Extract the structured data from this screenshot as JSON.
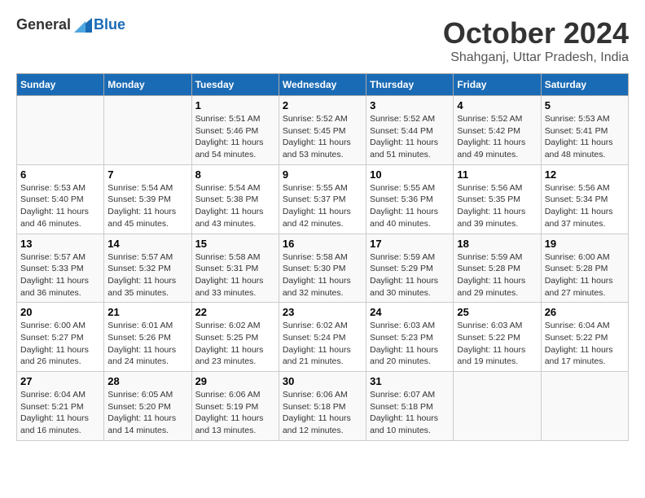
{
  "header": {
    "logo_general": "General",
    "logo_blue": "Blue",
    "month_title": "October 2024",
    "location": "Shahganj, Uttar Pradesh, India"
  },
  "weekdays": [
    "Sunday",
    "Monday",
    "Tuesday",
    "Wednesday",
    "Thursday",
    "Friday",
    "Saturday"
  ],
  "weeks": [
    [
      null,
      null,
      {
        "day": 1,
        "sunrise": "5:51 AM",
        "sunset": "5:46 PM",
        "daylight": "11 hours and 54 minutes."
      },
      {
        "day": 2,
        "sunrise": "5:52 AM",
        "sunset": "5:45 PM",
        "daylight": "11 hours and 53 minutes."
      },
      {
        "day": 3,
        "sunrise": "5:52 AM",
        "sunset": "5:44 PM",
        "daylight": "11 hours and 51 minutes."
      },
      {
        "day": 4,
        "sunrise": "5:52 AM",
        "sunset": "5:42 PM",
        "daylight": "11 hours and 49 minutes."
      },
      {
        "day": 5,
        "sunrise": "5:53 AM",
        "sunset": "5:41 PM",
        "daylight": "11 hours and 48 minutes."
      }
    ],
    [
      {
        "day": 6,
        "sunrise": "5:53 AM",
        "sunset": "5:40 PM",
        "daylight": "11 hours and 46 minutes."
      },
      {
        "day": 7,
        "sunrise": "5:54 AM",
        "sunset": "5:39 PM",
        "daylight": "11 hours and 45 minutes."
      },
      {
        "day": 8,
        "sunrise": "5:54 AM",
        "sunset": "5:38 PM",
        "daylight": "11 hours and 43 minutes."
      },
      {
        "day": 9,
        "sunrise": "5:55 AM",
        "sunset": "5:37 PM",
        "daylight": "11 hours and 42 minutes."
      },
      {
        "day": 10,
        "sunrise": "5:55 AM",
        "sunset": "5:36 PM",
        "daylight": "11 hours and 40 minutes."
      },
      {
        "day": 11,
        "sunrise": "5:56 AM",
        "sunset": "5:35 PM",
        "daylight": "11 hours and 39 minutes."
      },
      {
        "day": 12,
        "sunrise": "5:56 AM",
        "sunset": "5:34 PM",
        "daylight": "11 hours and 37 minutes."
      }
    ],
    [
      {
        "day": 13,
        "sunrise": "5:57 AM",
        "sunset": "5:33 PM",
        "daylight": "11 hours and 36 minutes."
      },
      {
        "day": 14,
        "sunrise": "5:57 AM",
        "sunset": "5:32 PM",
        "daylight": "11 hours and 35 minutes."
      },
      {
        "day": 15,
        "sunrise": "5:58 AM",
        "sunset": "5:31 PM",
        "daylight": "11 hours and 33 minutes."
      },
      {
        "day": 16,
        "sunrise": "5:58 AM",
        "sunset": "5:30 PM",
        "daylight": "11 hours and 32 minutes."
      },
      {
        "day": 17,
        "sunrise": "5:59 AM",
        "sunset": "5:29 PM",
        "daylight": "11 hours and 30 minutes."
      },
      {
        "day": 18,
        "sunrise": "5:59 AM",
        "sunset": "5:28 PM",
        "daylight": "11 hours and 29 minutes."
      },
      {
        "day": 19,
        "sunrise": "6:00 AM",
        "sunset": "5:28 PM",
        "daylight": "11 hours and 27 minutes."
      }
    ],
    [
      {
        "day": 20,
        "sunrise": "6:00 AM",
        "sunset": "5:27 PM",
        "daylight": "11 hours and 26 minutes."
      },
      {
        "day": 21,
        "sunrise": "6:01 AM",
        "sunset": "5:26 PM",
        "daylight": "11 hours and 24 minutes."
      },
      {
        "day": 22,
        "sunrise": "6:02 AM",
        "sunset": "5:25 PM",
        "daylight": "11 hours and 23 minutes."
      },
      {
        "day": 23,
        "sunrise": "6:02 AM",
        "sunset": "5:24 PM",
        "daylight": "11 hours and 21 minutes."
      },
      {
        "day": 24,
        "sunrise": "6:03 AM",
        "sunset": "5:23 PM",
        "daylight": "11 hours and 20 minutes."
      },
      {
        "day": 25,
        "sunrise": "6:03 AM",
        "sunset": "5:22 PM",
        "daylight": "11 hours and 19 minutes."
      },
      {
        "day": 26,
        "sunrise": "6:04 AM",
        "sunset": "5:22 PM",
        "daylight": "11 hours and 17 minutes."
      }
    ],
    [
      {
        "day": 27,
        "sunrise": "6:04 AM",
        "sunset": "5:21 PM",
        "daylight": "11 hours and 16 minutes."
      },
      {
        "day": 28,
        "sunrise": "6:05 AM",
        "sunset": "5:20 PM",
        "daylight": "11 hours and 14 minutes."
      },
      {
        "day": 29,
        "sunrise": "6:06 AM",
        "sunset": "5:19 PM",
        "daylight": "11 hours and 13 minutes."
      },
      {
        "day": 30,
        "sunrise": "6:06 AM",
        "sunset": "5:18 PM",
        "daylight": "11 hours and 12 minutes."
      },
      {
        "day": 31,
        "sunrise": "6:07 AM",
        "sunset": "5:18 PM",
        "daylight": "11 hours and 10 minutes."
      },
      null,
      null
    ]
  ],
  "labels": {
    "sunrise_prefix": "Sunrise: ",
    "sunset_prefix": "Sunset: ",
    "daylight_prefix": "Daylight: "
  }
}
